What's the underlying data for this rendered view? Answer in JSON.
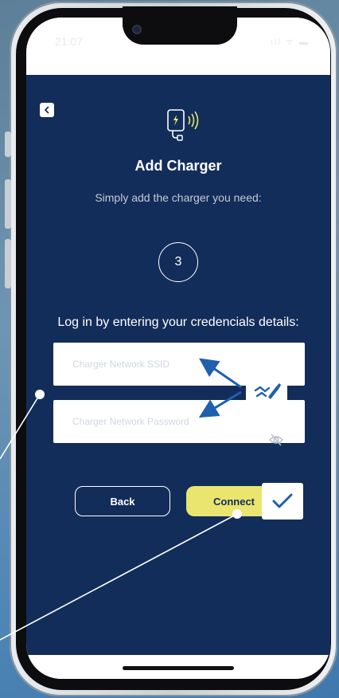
{
  "status_bar": {
    "time": "21:07",
    "icons": [
      "signal-icon",
      "wifi-icon",
      "battery-icon"
    ],
    "icons_text": ".ıll ᯤ ▬"
  },
  "header": {
    "back_icon": "chevron-left-icon",
    "charger_icon": "wireless-charger-icon"
  },
  "title": "Add Charger",
  "subtitle": "Simply add the charger you need:",
  "step": "3",
  "instruction": "Log in by entering your credencials details:",
  "form": {
    "ssid": {
      "value": "",
      "placeholder": "Charger Network SSID"
    },
    "password": {
      "value": "",
      "placeholder": "Charger Network Password",
      "toggle_icon": "eye-off-icon"
    }
  },
  "buttons": {
    "back_label": "Back",
    "connect_label": "Connect"
  },
  "badges": {
    "autofill_icon": "magic-wand-icon",
    "confirm_icon": "checkmark-icon"
  },
  "colors": {
    "app_background": "#132d5a",
    "accent_yellow": "#e9e56e",
    "annotation_blue": "#1f5fae",
    "text_white": "#ffffff",
    "subtitle_gray": "#c3cad6"
  }
}
